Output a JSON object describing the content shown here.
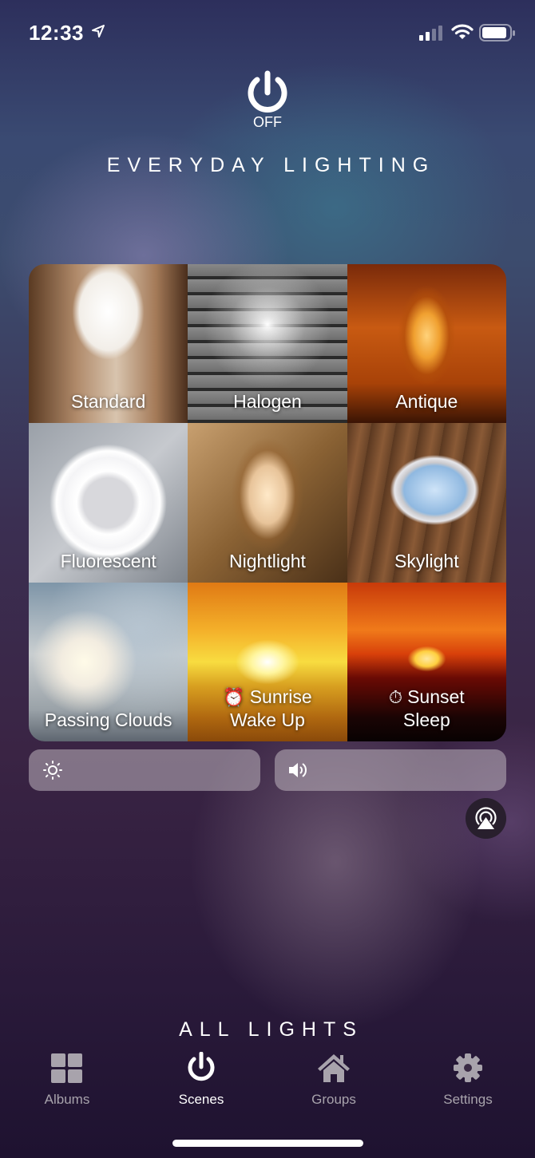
{
  "status_bar": {
    "time": "12:33",
    "icons": [
      "location-arrow-icon",
      "cellular-signal-icon",
      "wifi-icon",
      "battery-icon"
    ]
  },
  "header": {
    "power_state": "OFF",
    "title": "EVERYDAY LIGHTING"
  },
  "scenes": [
    {
      "label": "Standard",
      "icon": null
    },
    {
      "label": "Halogen",
      "icon": null
    },
    {
      "label": "Antique",
      "icon": null
    },
    {
      "label": "Fluorescent",
      "icon": null
    },
    {
      "label": "Nightlight",
      "icon": null
    },
    {
      "label": "Skylight",
      "icon": null
    },
    {
      "label": "Passing Clouds",
      "icon": null
    },
    {
      "label_line1": "Sunrise",
      "label_line2": "Wake Up",
      "icon": "alarm-clock-icon",
      "icon_glyph": "⏰"
    },
    {
      "label_line1": "Sunset",
      "label_line2": "Sleep",
      "icon": "stopwatch-icon",
      "icon_glyph": "⏱"
    }
  ],
  "controls": {
    "brightness_icon": "sun-icon",
    "volume_icon": "speaker-volume-icon",
    "airplay_icon": "airplay-icon"
  },
  "footer": {
    "group_title": "ALL LIGHTS"
  },
  "tabs": [
    {
      "label": "Albums",
      "icon": "grid-icon",
      "active": false
    },
    {
      "label": "Scenes",
      "icon": "power-icon",
      "active": true
    },
    {
      "label": "Groups",
      "icon": "house-icon",
      "active": false
    },
    {
      "label": "Settings",
      "icon": "gear-icon",
      "active": false
    }
  ],
  "colors": {
    "active_tab": "#ffffff",
    "inactive_tab": "#a8a3ac"
  }
}
